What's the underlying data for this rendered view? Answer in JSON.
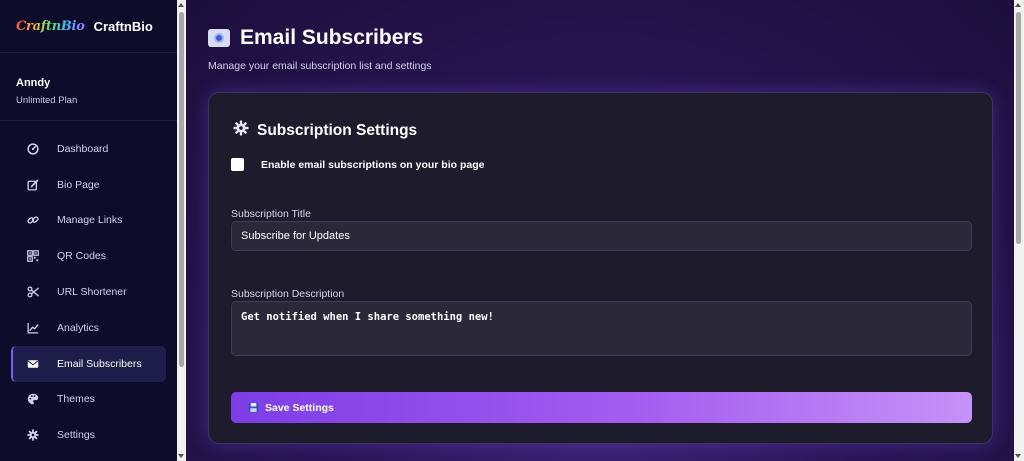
{
  "brand": {
    "logo_text": "CraftnBio",
    "name": "CraftnBio"
  },
  "user": {
    "name": "Anndy",
    "plan": "Unlimited Plan"
  },
  "sidebar": {
    "items": [
      {
        "label": "Dashboard",
        "icon": "dashboard-icon"
      },
      {
        "label": "Bio Page",
        "icon": "edit-icon"
      },
      {
        "label": "Manage Links",
        "icon": "link-icon"
      },
      {
        "label": "QR Codes",
        "icon": "qr-code-icon"
      },
      {
        "label": "URL Shortener",
        "icon": "scissors-icon"
      },
      {
        "label": "Analytics",
        "icon": "chart-line-icon"
      },
      {
        "label": "Email Subscribers",
        "icon": "envelope-icon",
        "active": true
      },
      {
        "label": "Themes",
        "icon": "palette-icon"
      },
      {
        "label": "Settings",
        "icon": "gear-icon"
      }
    ]
  },
  "page": {
    "title": "Email Subscribers",
    "subtitle": "Manage your email subscription list and settings"
  },
  "settings": {
    "title": "Subscription Settings",
    "enable_label": "Enable email subscriptions on your bio page",
    "enable_checked": false,
    "title_label": "Subscription Title",
    "title_value": "Subscribe for Updates",
    "description_label": "Subscription Description",
    "description_value": "Get notified when I share something new!",
    "save_label": "Save Settings"
  },
  "colors": {
    "sidebar_bg": "#0d0c2a",
    "accent": "#7b5cf0",
    "card_bg": "#1e1b2c",
    "button_gradient_start": "#7d3de6",
    "button_gradient_end": "#c592f7"
  }
}
